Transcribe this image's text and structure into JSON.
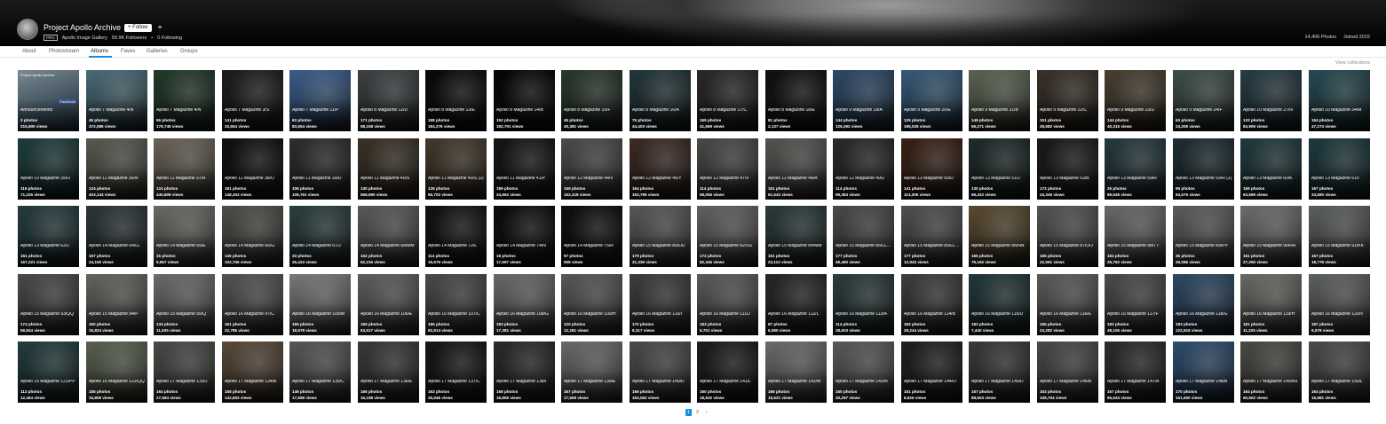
{
  "profile": {
    "name": "Project Apollo Archive",
    "follow_label": "+ Follow",
    "pro_badge": "PRO",
    "description": "Apollo Image Gallery",
    "followers": "59.9K Followers",
    "following": "0 Following",
    "photos_count": "14,406 Photos",
    "joined": "Joined 2015"
  },
  "subnav": {
    "tabs": [
      {
        "label": "About"
      },
      {
        "label": "Photostream"
      },
      {
        "label": "Albums"
      },
      {
        "label": "Faves"
      },
      {
        "label": "Galleries"
      },
      {
        "label": "Groups"
      }
    ],
    "active_index": 2,
    "view_collections": "View collections"
  },
  "intro_tile": {
    "title": "Project Apollo Archive",
    "facebook_badge": "Facebook",
    "heading": "Announcements",
    "photos": "3 photos",
    "views": "215,600 views"
  },
  "albums": [
    {
      "title": "Apollo 7 Magazine 4/N",
      "photos": "45 photos",
      "views": "372,086 views",
      "tone": "#4a6b78"
    },
    {
      "title": "Apollo 7 Magazine 4/N",
      "photos": "55 photos",
      "views": "178,745 views",
      "tone": "#233a2c"
    },
    {
      "title": "Apollo 7 Magazine 3/S",
      "photos": "141 photos",
      "views": "33,654 views",
      "tone": "#1e1e1e"
    },
    {
      "title": "Apollo 7 Magazine 11/P",
      "photos": "63 photos",
      "views": "83,654 views",
      "tone": "#3a5d8c"
    },
    {
      "title": "Apollo 8 Magazine 12/D",
      "photos": "171 photos",
      "views": "58,158 views",
      "tone": "#3d4244"
    },
    {
      "title": "Apollo 8 Magazine 13/E",
      "photos": "188 photos",
      "views": "184,276 views",
      "tone": "#0a0a0a"
    },
    {
      "title": "Apollo 8 Magazine 14/B",
      "photos": "152 photos",
      "views": "182,701 views",
      "tone": "#060606"
    },
    {
      "title": "Apollo 8 Magazine 15/F",
      "photos": "45 photos",
      "views": "40,381 views",
      "tone": "#29382e"
    },
    {
      "title": "Apollo 8 Magazine 16/A",
      "photos": "75 photos",
      "views": "44,403 views",
      "tone": "#22363a"
    },
    {
      "title": "Apollo 8 Magazine 17/C",
      "photos": "169 photos",
      "views": "41,669 views",
      "tone": "#2a2a2a"
    },
    {
      "title": "Apollo 8 Magazine 18/E",
      "photos": "81 photos",
      "views": "2,137 views",
      "tone": "#111111"
    },
    {
      "title": "Apollo 9 Magazine 19/A",
      "photos": "144 photos",
      "views": "126,292 views",
      "tone": "#2e4a6a"
    },
    {
      "title": "Apollo 9 Magazine 20/E",
      "photos": "125 photos",
      "views": "195,025 views",
      "tone": "#365a7a"
    },
    {
      "title": "Apollo 9 Magazine 21/B",
      "photos": "146 photos",
      "views": "56,271 views",
      "tone": "#5c6452"
    },
    {
      "title": "Apollo 9 Magazine 22/C",
      "photos": "151 photos",
      "views": "28,682 views",
      "tone": "#3a3129"
    },
    {
      "title": "Apollo 9 Magazine 23/D",
      "photos": "144 photos",
      "views": "40,315 views",
      "tone": "#4a4031"
    },
    {
      "title": "Apollo 9 Magazine 24/F",
      "photos": "63 photos",
      "views": "24,206 views",
      "tone": "#3e4f4a"
    },
    {
      "title": "Apollo 10 Magazine 27/N",
      "photos": "133 photos",
      "views": "84,906 views",
      "tone": "#273c44"
    },
    {
      "title": "Apollo 10 Magazine 34/M",
      "photos": "164 photos",
      "views": "47,274 views",
      "tone": "#264a52"
    },
    {
      "title": "Apollo 10 Magazine 35/O",
      "photos": "116 photos",
      "views": "71,225 views",
      "tone": "#1e3d3d"
    },
    {
      "title": "Apollo 11 Magazine 36/N",
      "photos": "124 photos",
      "views": "403,144 views",
      "tone": "#5a5a52"
    },
    {
      "title": "Apollo 11 Magazine 37/R",
      "photos": "124 photos",
      "views": "440,809 views",
      "tone": "#6b6458"
    },
    {
      "title": "Apollo 11 Magazine 38/O",
      "photos": "181 photos",
      "views": "148,403 views",
      "tone": "#101010"
    },
    {
      "title": "Apollo 11 Magazine 39/D",
      "photos": "108 photos",
      "views": "108,761 views",
      "tone": "#2e2e2e"
    },
    {
      "title": "Apollo 11 Magazine 40/S",
      "photos": "130 photos",
      "views": "558,990 views",
      "tone": "#3a3226"
    },
    {
      "title": "Apollo 11 Magazine 40/S (2)",
      "photos": "128 photos",
      "views": "65,702 views",
      "tone": "#44392b"
    },
    {
      "title": "Apollo 11 Magazine 41/P",
      "photos": "189 photos",
      "views": "34,962 views",
      "tone": "#151515"
    },
    {
      "title": "Apollo 12 Magazine 44/V",
      "photos": "159 photos",
      "views": "152,418 views",
      "tone": "#4c4c4c"
    },
    {
      "title": "Apollo 12 Magazine 45/Y",
      "photos": "154 photos",
      "views": "163,795 views",
      "tone": "#3d2a24"
    },
    {
      "title": "Apollo 12 Magazine 47/V",
      "photos": "114 photos",
      "views": "98,055 views",
      "tone": "#4a4a48"
    },
    {
      "title": "Apollo 12 Magazine 48/A",
      "photos": "151 photos",
      "views": "61,542 views",
      "tone": "#555552"
    },
    {
      "title": "Apollo 12 Magazine 49/Z",
      "photos": "114 photos",
      "views": "99,384 views",
      "tone": "#2a2a2a"
    },
    {
      "title": "Apollo 13 Magazine 50/D",
      "photos": "141 photos",
      "views": "113,305 views",
      "tone": "#3a2216"
    },
    {
      "title": "Apollo 13 Magazine 51/J",
      "photos": "130 photos",
      "views": "66,422 views",
      "tone": "#1e2a2a"
    },
    {
      "title": "Apollo 13 Magazine 53/B",
      "photos": "172 photos",
      "views": "44,349 views",
      "tone": "#1a1a1a"
    },
    {
      "title": "Apollo 13 Magazine 59/R",
      "photos": "25 photos",
      "views": "89,549 views",
      "tone": "#253a3f"
    },
    {
      "title": "Apollo 13 Magazine 59/R (2)",
      "photos": "95 photos",
      "views": "94,676 views",
      "tone": "#1e2e33"
    },
    {
      "title": "Apollo 13 Magazine 60/K",
      "photos": "159 photos",
      "views": "63,589 views",
      "tone": "#1f3b3f"
    },
    {
      "title": "Apollo 13 Magazine 61/I",
      "photos": "167 photos",
      "views": "33,580 views",
      "tone": "#1d3a3e"
    },
    {
      "title": "Apollo 13 Magazine 62/J",
      "photos": "161 photos",
      "views": "167,221 views",
      "tone": "#253d40"
    },
    {
      "title": "Apollo 14 Magazine 64/LL",
      "photos": "157 photos",
      "views": "24,150 views",
      "tone": "#2c3638"
    },
    {
      "title": "Apollo 14 Magazine 65/E",
      "photos": "15 photos",
      "views": "9,557 views",
      "tone": "#6a6a66"
    },
    {
      "title": "Apollo 14 Magazine 66/G",
      "photos": "145 photos",
      "views": "102,706 views",
      "tone": "#4e4e4a"
    },
    {
      "title": "Apollo 14 Magazine 67/J",
      "photos": "33 photos",
      "views": "25,423 views",
      "tone": "#2b3f3f"
    },
    {
      "title": "Apollo 14 Magazine 68/MM",
      "photos": "152 photos",
      "views": "62,215 views",
      "tone": "#5a5a58"
    },
    {
      "title": "Apollo 14 Magazine 72/L",
      "photos": "114 photos",
      "views": "19,575 views",
      "tone": "#121212"
    },
    {
      "title": "Apollo 14 Magazine 74/N",
      "photos": "18 photos",
      "views": "17,697 views",
      "tone": "#0c0c0c"
    },
    {
      "title": "Apollo 14 Magazine 75/R",
      "photos": "97 photos",
      "views": "508 views",
      "tone": "#0e0e0e"
    },
    {
      "title": "Apollo 15 Magazine 80/DD",
      "photos": "179 photos",
      "views": "31,335 views",
      "tone": "#585856"
    },
    {
      "title": "Apollo 15 Magazine 82/SS",
      "photos": "172 photos",
      "views": "82,345 views",
      "tone": "#626260"
    },
    {
      "title": "Apollo 15 Magazine 84/MM",
      "photos": "151 photos",
      "views": "23,112 views",
      "tone": "#2a3a3a"
    },
    {
      "title": "Apollo 15 Magazine 85/LL (1st mixed dye)",
      "photos": "177 photos",
      "views": "49,480 views",
      "tone": "#4a4a4a"
    },
    {
      "title": "Apollo 15 Magazine 85/LL (2)",
      "photos": "177 photos",
      "views": "12,943 views",
      "tone": "#505050"
    },
    {
      "title": "Apollo 15 Magazine 86/NN",
      "photos": "165 photos",
      "views": "76,162 views",
      "tone": "#5a4a30"
    },
    {
      "title": "Apollo 15 Magazine 87/OO",
      "photos": "165 photos",
      "views": "22,591 views",
      "tone": "#555553"
    },
    {
      "title": "Apollo 15 Magazine 88/TT",
      "photos": "154 photos",
      "views": "25,762 views",
      "tone": "#6a6a68"
    },
    {
      "title": "Apollo 15 Magazine 89/PP",
      "photos": "35 photos",
      "views": "26,086 views",
      "tone": "#5e5e5c"
    },
    {
      "title": "Apollo 15 Magazine 90/RR",
      "photos": "161 photos",
      "views": "27,250 views",
      "tone": "#6e6e6c"
    },
    {
      "title": "Apollo 15 Magazine 91/KK",
      "photos": "167 photos",
      "views": "18,776 views",
      "tone": "#5c605e"
    },
    {
      "title": "Apollo 15 Magazine 93/QQ",
      "photos": "174 photos",
      "views": "59,844 views",
      "tone": "#4a4a48"
    },
    {
      "title": "Apollo 15 Magazine 94/P",
      "photos": "160 photos",
      "views": "15,824 views",
      "tone": "#646460"
    },
    {
      "title": "Apollo 15 Magazine 95/Q",
      "photos": "134 photos",
      "views": "11,535 views",
      "tone": "#6c6c6a"
    },
    {
      "title": "Apollo 16 Magazine 97/C",
      "photos": "161 photos",
      "views": "22,785 views",
      "tone": "#545452"
    },
    {
      "title": "Apollo 16 Magazine 105/M",
      "photos": "165 photos",
      "views": "18,978 views",
      "tone": "#7a7a78"
    },
    {
      "title": "Apollo 16 Magazine 106/E",
      "photos": "165 photos",
      "views": "63,517 views",
      "tone": "#5e5e5c"
    },
    {
      "title": "Apollo 16 Magazine 107/C",
      "photos": "165 photos",
      "views": "82,814 views",
      "tone": "#4a4a48"
    },
    {
      "title": "Apollo 16 Magazine 108/G",
      "photos": "183 photos",
      "views": "17,381 views",
      "tone": "#6a6a68"
    },
    {
      "title": "Apollo 16 Magazine 109/H",
      "photos": "120 photos",
      "views": "12,281 views",
      "tone": "#585856"
    },
    {
      "title": "Apollo 16 Magazine 110/I",
      "photos": "170 photos",
      "views": "8,317 views",
      "tone": "#3e3e3c"
    },
    {
      "title": "Apollo 16 Magazine 111/J",
      "photos": "183 photos",
      "views": "5,701 views",
      "tone": "#5a5a58"
    },
    {
      "title": "Apollo 16 Magazine 112/L",
      "photos": "87 photos",
      "views": "6,080 views",
      "tone": "#282828"
    },
    {
      "title": "Apollo 16 Magazine 113/A",
      "photos": "114 photos",
      "views": "28,623 views",
      "tone": "#2a3c3c"
    },
    {
      "title": "Apollo 16 Magazine 114/B",
      "photos": "183 photos",
      "views": "29,244 views",
      "tone": "#3e3e3c"
    },
    {
      "title": "Apollo 16 Magazine 115/D",
      "photos": "183 photos",
      "views": "7,440 views",
      "tone": "#22383a"
    },
    {
      "title": "Apollo 16 Magazine 116/E",
      "photos": "165 photos",
      "views": "24,282 views",
      "tone": "#5c5c5a"
    },
    {
      "title": "Apollo 16 Magazine 117/F",
      "photos": "183 photos",
      "views": "48,105 views",
      "tone": "#4c4c4a"
    },
    {
      "title": "Apollo 16 Magazine 118/G",
      "photos": "183 photos",
      "views": "122,915 views",
      "tone": "#2e4a66"
    },
    {
      "title": "Apollo 16 Magazine 119/H",
      "photos": "161 photos",
      "views": "11,225 views",
      "tone": "#6a6a66"
    },
    {
      "title": "Apollo 16 Magazine 120/V",
      "photos": "187 photos",
      "views": "9,578 views",
      "tone": "#5e6260"
    },
    {
      "title": "Apollo 16 Magazine 121/PP",
      "photos": "112 photos",
      "views": "12,464 views",
      "tone": "#223c3e"
    },
    {
      "title": "Apollo 16 Magazine 122/QQ",
      "photos": "155 photos",
      "views": "15,806 views",
      "tone": "#5a6250"
    },
    {
      "title": "Apollo 17 Magazine 133/J",
      "photos": "164 photos",
      "views": "27,584 views",
      "tone": "#4a4a48"
    },
    {
      "title": "Apollo 17 Magazine 134/B",
      "photos": "158 photos",
      "views": "142,803 views",
      "tone": "#5a4a3a"
    },
    {
      "title": "Apollo 17 Magazine 135/C",
      "photos": "149 photos",
      "views": "17,598 views",
      "tone": "#585858"
    },
    {
      "title": "Apollo 17 Magazine 136/E",
      "photos": "166 photos",
      "views": "15,198 views",
      "tone": "#3a3a3a"
    },
    {
      "title": "Apollo 17 Magazine 137/C",
      "photos": "163 photos",
      "views": "25,946 views",
      "tone": "#161616"
    },
    {
      "title": "Apollo 17 Magazine 138/I",
      "photos": "158 photos",
      "views": "18,855 views",
      "tone": "#2a2a2a"
    },
    {
      "title": "Apollo 17 Magazine 139/E",
      "photos": "167 photos",
      "views": "17,559 views",
      "tone": "#6a6a68"
    },
    {
      "title": "Apollo 17 Magazine 140/D",
      "photos": "156 photos",
      "views": "163,062 views",
      "tone": "#4c4c4a"
    },
    {
      "title": "Apollo 17 Magazine 141/L",
      "photos": "160 photos",
      "views": "18,632 views",
      "tone": "#1c1c1c"
    },
    {
      "title": "Apollo 17 Magazine 142/M",
      "photos": "166 photos",
      "views": "15,621 views",
      "tone": "#6c6c6a"
    },
    {
      "title": "Apollo 17 Magazine 143/N",
      "photos": "150 photos",
      "views": "30,297 views",
      "tone": "#5a5a58"
    },
    {
      "title": "Apollo 17 Magazine 144/O",
      "photos": "151 photos",
      "views": "8,626 views",
      "tone": "#202020"
    },
    {
      "title": "Apollo 17 Magazine 145/D",
      "photos": "157 photos",
      "views": "88,603 views",
      "tone": "#3a3a38"
    },
    {
      "title": "Apollo 17 Magazine 146/B",
      "photos": "163 photos",
      "views": "108,704 views",
      "tone": "#4a4a48"
    },
    {
      "title": "Apollo 17 Magazine 147/A",
      "photos": "157 photos",
      "views": "66,634 views",
      "tone": "#2c2c2c"
    },
    {
      "title": "Apollo 17 Magazine 148/B",
      "photos": "170 photos",
      "views": "161,500 views",
      "tone": "#2e4e70"
    },
    {
      "title": "Apollo 17 Magazine 149/AX",
      "photos": "164 photos",
      "views": "60,502 views",
      "tone": "#4a4a46"
    },
    {
      "title": "Apollo 17 Magazine 150/L",
      "photos": "164 photos",
      "views": "15,981 views",
      "tone": "#4c4c4a"
    }
  ],
  "pagination": {
    "pages": [
      "1",
      "2"
    ],
    "current": "1",
    "next": "›"
  },
  "colors": {
    "accent": "#128fdc",
    "header_bg": "#000000",
    "page_bg": "#ffffff"
  }
}
